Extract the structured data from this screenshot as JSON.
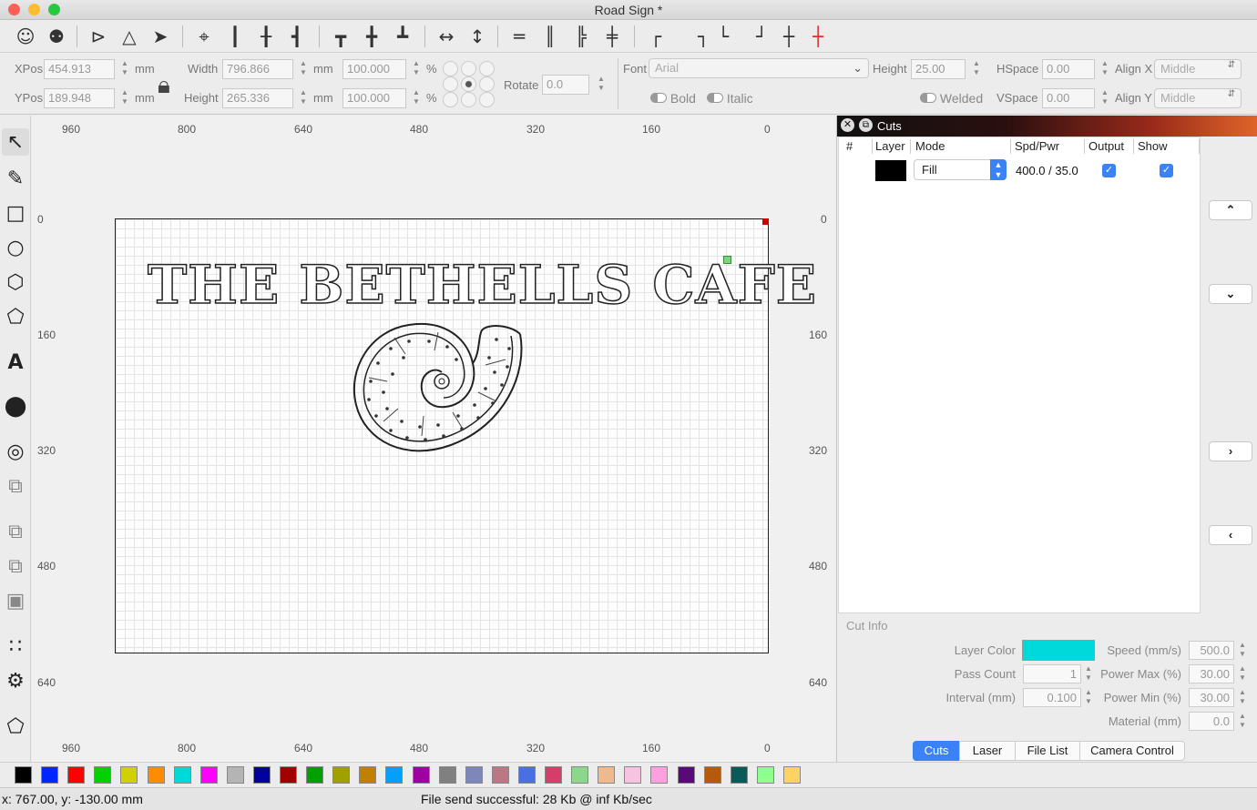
{
  "window": {
    "title": "Road Sign *"
  },
  "position": {
    "xpos_label": "XPos",
    "xpos_value": "454.913",
    "ypos_label": "YPos",
    "ypos_value": "189.948",
    "unit": "mm",
    "width_label": "Width",
    "width_value": "796.866",
    "height_label": "Height",
    "height_value": "265.336",
    "scale_w": "100.000",
    "scale_h": "100.000",
    "percent": "%",
    "rotate_label": "Rotate",
    "rotate_value": "0.0"
  },
  "text_props": {
    "font_label": "Font",
    "font_value": "Arial",
    "height_label": "Height",
    "height_value": "25.00",
    "hspace_label": "HSpace",
    "hspace_value": "0.00",
    "vspace_label": "VSpace",
    "vspace_value": "0.00",
    "alignx_label": "Align X",
    "alignx_value": "Middle",
    "aligny_label": "Align Y",
    "aligny_value": "Middle",
    "bold_label": "Bold",
    "italic_label": "Italic",
    "welded_label": "Welded"
  },
  "ruler": {
    "top": [
      "960",
      "800",
      "640",
      "480",
      "320",
      "160",
      "0"
    ],
    "left": [
      "0",
      "160",
      "320",
      "480",
      "640"
    ]
  },
  "design": {
    "sign_text": "THE BETHELLS CAFE"
  },
  "cuts": {
    "panel_title": "Cuts",
    "headers": [
      "#",
      "Layer",
      "Mode",
      "Spd/Pwr",
      "Output",
      "Show"
    ],
    "rows": [
      {
        "mode": "Fill",
        "spd_pwr": "400.0 / 35.0",
        "layer_color": "#000000"
      }
    ]
  },
  "cut_info": {
    "title": "Cut Info",
    "layer_color_label": "Layer Color",
    "layer_color": "#00d9d9",
    "pass_count_label": "Pass Count",
    "pass_count": "1",
    "interval_label": "Interval (mm)",
    "interval": "0.100",
    "speed_label": "Speed (mm/s)",
    "speed": "500.0",
    "power_max_label": "Power Max (%)",
    "power_max": "30.00",
    "power_min_label": "Power Min (%)",
    "power_min": "30.00",
    "material_label": "Material (mm)",
    "material": "0.0"
  },
  "tabs": [
    "Cuts",
    "Laser",
    "File List",
    "Camera Control"
  ],
  "palette": [
    "#000000",
    "#0026ff",
    "#ff0000",
    "#00d100",
    "#d1d100",
    "#ff8c00",
    "#00d9d9",
    "#ff00ff",
    "#b4b4b4",
    "#0000a0",
    "#a00000",
    "#00a000",
    "#a0a000",
    "#c08000",
    "#00a0ff",
    "#a000a0",
    "#808080",
    "#7d87b9",
    "#bb7784",
    "#4a6fe3",
    "#d33f6a",
    "#8cd78c",
    "#f0b98d",
    "#f6c4e1",
    "#fe9fe0",
    "#5a0a78",
    "#b45a0a",
    "#0a5a5a",
    "#8cff8c",
    "#ffd264"
  ],
  "status": {
    "coords": "x: 767.00, y: -130.00 mm",
    "message": "File send successful: 28 Kb @ inf Kb/sec"
  }
}
